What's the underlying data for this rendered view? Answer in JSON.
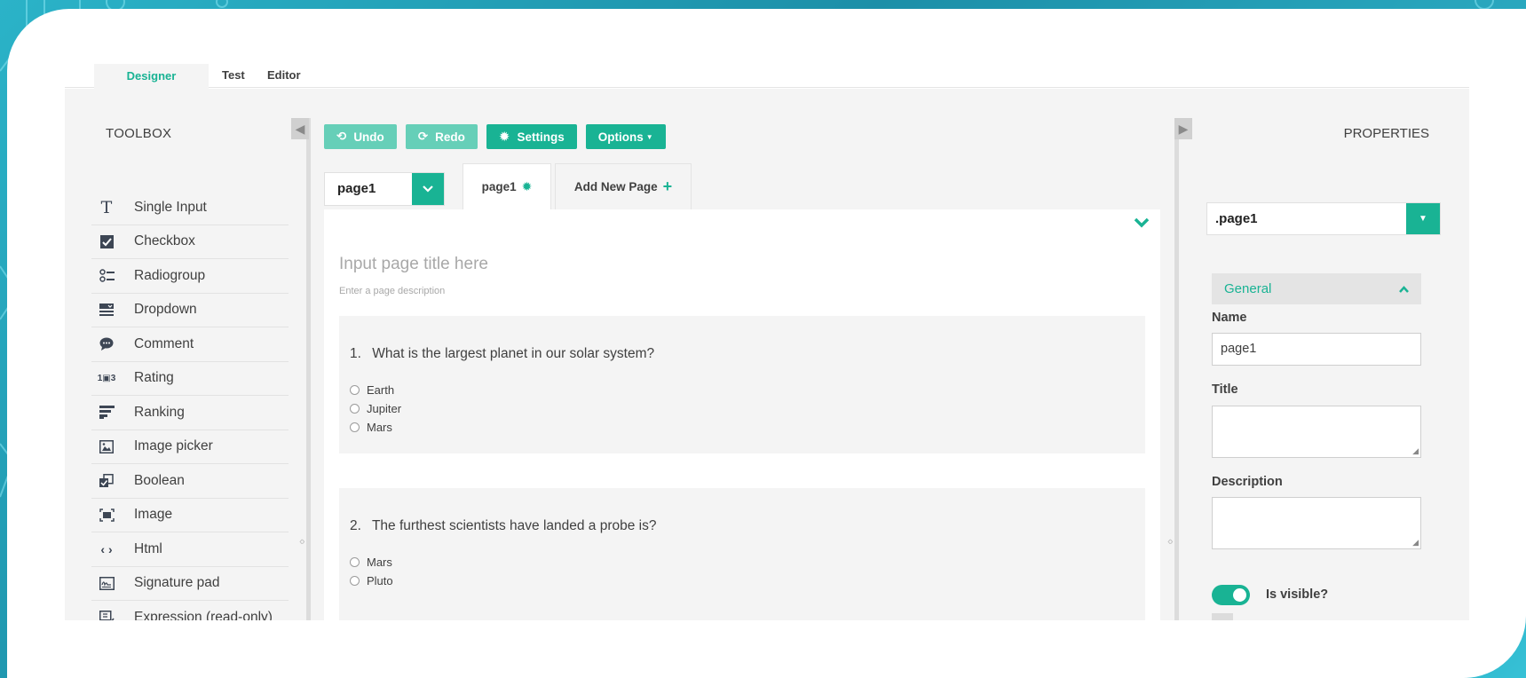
{
  "colors": {
    "accent": "#19b394",
    "accent_light": "#66cfb8",
    "panel_bg": "#f4f4f4",
    "text": "#404040"
  },
  "top_tabs": [
    {
      "label": "Designer",
      "active": true
    },
    {
      "label": "Test",
      "active": false
    },
    {
      "label": "Editor",
      "active": false
    }
  ],
  "toolbox": {
    "title": "TOOLBOX",
    "items": [
      {
        "label": "Single Input",
        "icon": "text-icon"
      },
      {
        "label": "Checkbox",
        "icon": "checkbox-icon"
      },
      {
        "label": "Radiogroup",
        "icon": "radiogroup-icon"
      },
      {
        "label": "Dropdown",
        "icon": "dropdown-icon"
      },
      {
        "label": "Comment",
        "icon": "comment-icon"
      },
      {
        "label": "Rating",
        "icon": "rating-icon"
      },
      {
        "label": "Ranking",
        "icon": "ranking-icon"
      },
      {
        "label": "Image picker",
        "icon": "image-picker-icon"
      },
      {
        "label": "Boolean",
        "icon": "boolean-icon"
      },
      {
        "label": "Image",
        "icon": "image-icon"
      },
      {
        "label": "Html",
        "icon": "html-icon"
      },
      {
        "label": "Signature pad",
        "icon": "signature-icon"
      },
      {
        "label": "Expression (read-only)",
        "icon": "expression-icon"
      }
    ]
  },
  "toolbar": {
    "undo_label": "Undo",
    "redo_label": "Redo",
    "settings_label": "Settings",
    "options_label": "Options"
  },
  "page_select": {
    "value": "page1"
  },
  "page_tabs": {
    "current": "page1",
    "add_label": "Add New Page"
  },
  "design": {
    "title_placeholder": "Input page title here",
    "description_placeholder": "Enter a page description",
    "questions": [
      {
        "number": "1.",
        "title": "What is the largest planet in our solar system?",
        "choices": [
          "Earth",
          "Jupiter",
          "Mars"
        ]
      },
      {
        "number": "2.",
        "title": "The furthest scientists have landed a probe is?",
        "choices": [
          "Mars",
          "Pluto"
        ]
      }
    ]
  },
  "properties": {
    "title": "PROPERTIES",
    "object_select": ".page1",
    "section": "General",
    "name_label": "Name",
    "name_value": "page1",
    "title_label": "Title",
    "description_label": "Description",
    "visible_label": "Is visible?",
    "visible": true
  }
}
